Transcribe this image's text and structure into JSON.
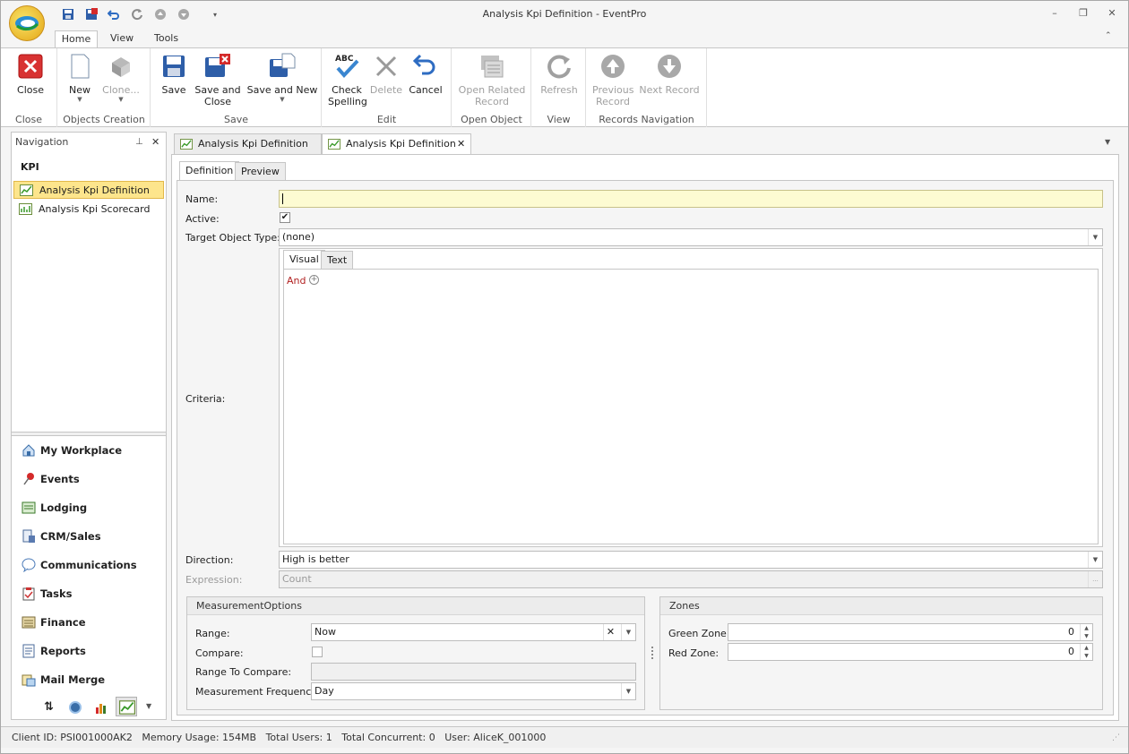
{
  "app": {
    "title": "Analysis Kpi Definition - EventPro"
  },
  "ribbon_tabs": [
    {
      "label": "Home"
    },
    {
      "label": "View"
    },
    {
      "label": "Tools"
    }
  ],
  "ribbon": {
    "groups": [
      {
        "label": "Close"
      },
      {
        "label": "Objects Creation"
      },
      {
        "label": "Save"
      },
      {
        "label": "Edit"
      },
      {
        "label": "Open Object"
      },
      {
        "label": "View"
      },
      {
        "label": "Records Navigation"
      }
    ],
    "buttons": {
      "close": "Close",
      "new": "New",
      "clone": "Clone...",
      "save": "Save",
      "save_close_1": "Save and",
      "save_close_2": "Close",
      "save_new": "Save and New",
      "check_1": "Check",
      "check_2": "Spelling",
      "check_icon_text": "ABC",
      "delete": "Delete",
      "cancel": "Cancel",
      "open_related_1": "Open Related",
      "open_related_2": "Record",
      "refresh": "Refresh",
      "prev_1": "Previous",
      "prev_2": "Record",
      "next": "Next Record"
    }
  },
  "navigation": {
    "header": "Navigation",
    "section": "KPI",
    "items": [
      {
        "label": "Analysis Kpi Definition"
      },
      {
        "label": "Analysis Kpi Scorecard"
      }
    ],
    "modules": [
      {
        "label": "My Workplace"
      },
      {
        "label": "Events"
      },
      {
        "label": "Lodging"
      },
      {
        "label": "CRM/Sales"
      },
      {
        "label": "Communications"
      },
      {
        "label": "Tasks"
      },
      {
        "label": "Finance"
      },
      {
        "label": "Reports"
      },
      {
        "label": "Mail Merge"
      }
    ]
  },
  "doc_tabs": [
    {
      "label": "Analysis Kpi Definition"
    },
    {
      "label": "Analysis Kpi Definition"
    }
  ],
  "inner_tabs": [
    {
      "label": "Definition"
    },
    {
      "label": "Preview"
    }
  ],
  "form": {
    "name_label": "Name:",
    "name_value": "",
    "active_label": "Active:",
    "active_checked": true,
    "target_label": "Target Object Type:",
    "target_value": "(none)",
    "criteria_label": "Criteria:",
    "criteria_tabs": [
      {
        "label": "Visual"
      },
      {
        "label": "Text"
      }
    ],
    "criteria_and": "And",
    "direction_label": "Direction:",
    "direction_value": "High is better",
    "expression_label": "Expression:",
    "expression_value": "Count",
    "expression_button": "..."
  },
  "measurement": {
    "title": "MeasurementOptions",
    "range_label": "Range:",
    "range_value": "Now",
    "compare_label": "Compare:",
    "range_compare_label": "Range To Compare:",
    "frequency_label": "Measurement Frequency:",
    "frequency_value": "Day"
  },
  "zones": {
    "title": "Zones",
    "green_label": "Green Zone:",
    "green_value": "0",
    "red_label": "Red Zone:",
    "red_value": "0"
  },
  "status": {
    "text": "Client ID: PSI001000AK2   Memory Usage: 154MB   Total Users: 1   Total Concurrent: 0   User: AliceK_001000"
  }
}
